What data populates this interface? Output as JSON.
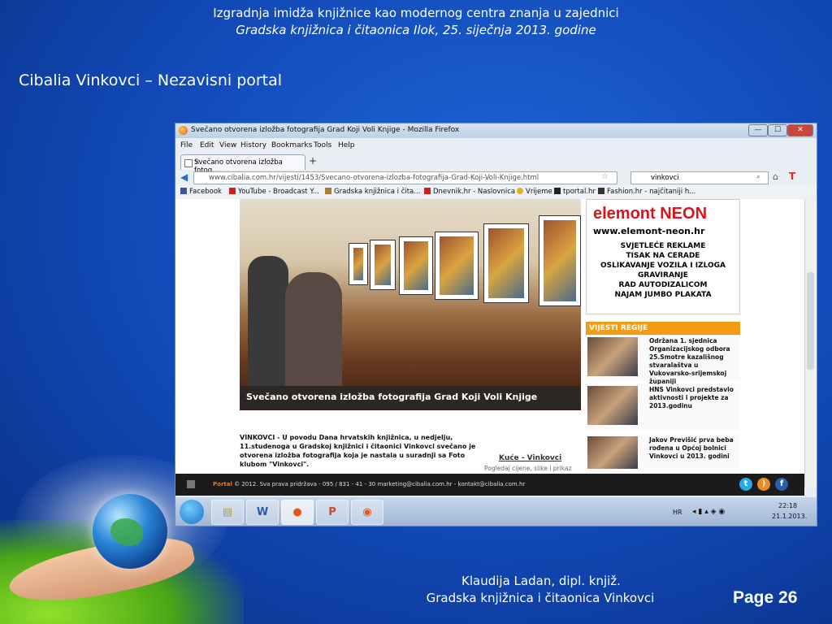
{
  "slide": {
    "header_line1": "Izgradnja imidža knjižnice kao modernog centra znanja u zajednici",
    "header_line2": "Gradska knjižnica i čitaonica Ilok, 25. siječnja 2013. godine",
    "title": "Cibalia Vinkovci – Nezavisni portal",
    "footer_line1": "Klaudija Ladan, dipl. knjiž.",
    "footer_line2": "Gradska knjižnica i čitaonica Vinkovci",
    "page_label": "Page 26"
  },
  "browser": {
    "window_title": "Svečano otvorena izložba fotografija Grad Koji Voli Knjige - Mozilla Firefox",
    "window_controls": {
      "minimize": "—",
      "maximize": "☐",
      "close": "✕"
    },
    "menu": [
      "File",
      "Edit",
      "View",
      "History",
      "Bookmarks",
      "Tools",
      "Help"
    ],
    "tab_label": "Svečano otvorena izložba fotog...",
    "tab_close": "×",
    "new_tab": "+",
    "url": "www.cibalia.com.hr/vijesti/1453/Svecano-otvorena-izlozba-fotografija-Grad-Koji-Voli-Knjige.html",
    "search_value": "vinkovci",
    "bookmarks": [
      "Facebook",
      "YouTube - Broadcast Y...",
      "Gradska knjižnica i čita...",
      "Dnevnik.hr - Naslovnica",
      "Vrijeme",
      "tportal.hr",
      "Fashion.hr - najčitaniji h..."
    ]
  },
  "page": {
    "photo_caption": "Svečano otvorena izložba fotografija Grad Koji Voli Knjige",
    "lead": "VINKOVCI - U povodu Dana hrvatskih knjižnica, u nedjelju, 11.studenoga u Gradskoj knjižnici i čitaonici Vinkovci svečano je otvorena izložba fotografija koja je nastala u suradnji sa Foto klubom \"Vinkovci\".",
    "kuce_link": "Kuće - Vinkovci",
    "kuce_sub": "Pogledaj cijene, slike i prikaz",
    "ad": {
      "logo": "elemont NEON",
      "site": "www.elemont-neon.hr",
      "lines": [
        "SVJETLEĆE REKLAME",
        "TISAK NA CERADE",
        "OSLIKAVANJE VOZILA I IZLOGA",
        "GRAVIRANJE",
        "RAD AUTODIZALICOM",
        "NAJAM JUMBO PLAKATA"
      ]
    },
    "news_heading": "VIJESTI REGIJE",
    "news": [
      "Održana 1. sjednica Organizacijskog odbora 25.Smotre kazališnog stvaralaštva u Vukovarsko-srijemskoj županiji",
      "HNS Vinkovci predstavio aktivnosti i projekte za 2013.godinu",
      "Jakov Previšić prva beba rođena u Općoj bolnici Vinkovci u 2013. godini"
    ],
    "footer_brand": "Portal",
    "footer_text": "© 2012. Sva prava pridržava - 095 / 831 - 41 - 30 marketing@cibalia.com.hr - kontakt@cibalia.com.hr"
  },
  "taskbar": {
    "lang": "HR",
    "time": "22:18",
    "date": "21.1.2013."
  }
}
